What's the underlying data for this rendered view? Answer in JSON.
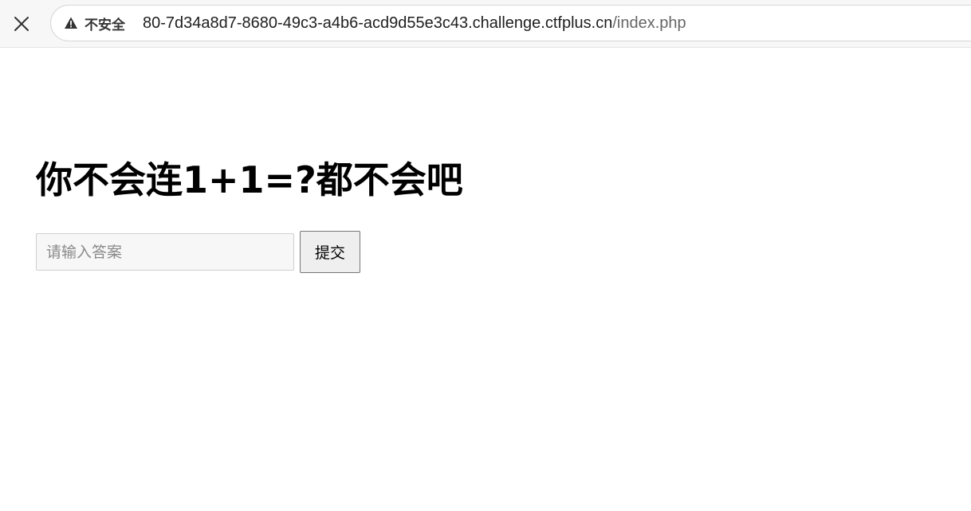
{
  "browser": {
    "close_icon": "close-icon",
    "security_icon": "warning-triangle-icon",
    "security_label": "不安全",
    "url_host": "80-7d34a8d7-8680-49c3-a4b6-acd9d55e3c43.challenge.ctfplus.cn",
    "url_path": "/index.php"
  },
  "page": {
    "heading": "你不会连1+1=?都不会吧",
    "answer_placeholder": "请输入答案",
    "answer_value": "",
    "submit_label": "提交"
  }
}
